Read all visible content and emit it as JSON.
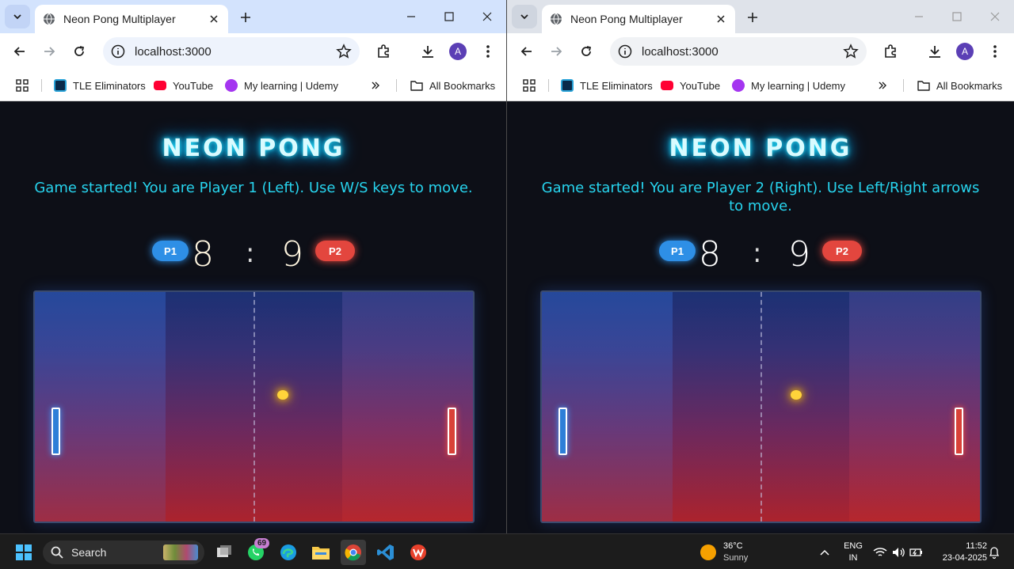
{
  "windows": [
    {
      "tab_title": "Neon Pong Multiplayer",
      "url": "localhost:3000",
      "avatar_letter": "A",
      "bookmarks": [
        "TLE Eliminators",
        "YouTube",
        "My learning | Udemy"
      ],
      "all_bookmarks": "All Bookmarks",
      "game": {
        "title": "NEON PONG",
        "status": "Game started! You are Player 1 (Left). Use W/S keys to move.",
        "p1_label": "P1",
        "p2_label": "P2",
        "score_p1": "8",
        "score_sep": ":",
        "score_p2": "9"
      }
    },
    {
      "tab_title": "Neon Pong Multiplayer",
      "url": "localhost:3000",
      "avatar_letter": "A",
      "bookmarks": [
        "TLE Eliminators",
        "YouTube",
        "My learning | Udemy"
      ],
      "all_bookmarks": "All Bookmarks",
      "game": {
        "title": "NEON PONG",
        "status": "Game started! You are Player 2 (Right). Use Left/Right arrows to move.",
        "p1_label": "P1",
        "p2_label": "P2",
        "score_p1": "8",
        "score_sep": ":",
        "score_p2": "9"
      }
    }
  ],
  "colors": {
    "neon_cyan": "#27d4ee",
    "p1_blue": "#2e8fe6",
    "p2_red": "#e3463e",
    "ball_yellow": "#ffd43a"
  },
  "taskbar": {
    "search_label": "Search",
    "whatsapp_badge": "69",
    "weather_temp": "36°C",
    "weather_desc": "Sunny",
    "lang_1": "ENG",
    "lang_2": "IN",
    "time": "11:52",
    "date": "23-04-2025",
    "icons": [
      "windows-start-icon",
      "search-icon",
      "task-view-icon",
      "whatsapp-icon",
      "edge-icon",
      "file-explorer-icon",
      "chrome-icon",
      "vscode-icon",
      "wps-office-icon"
    ]
  }
}
